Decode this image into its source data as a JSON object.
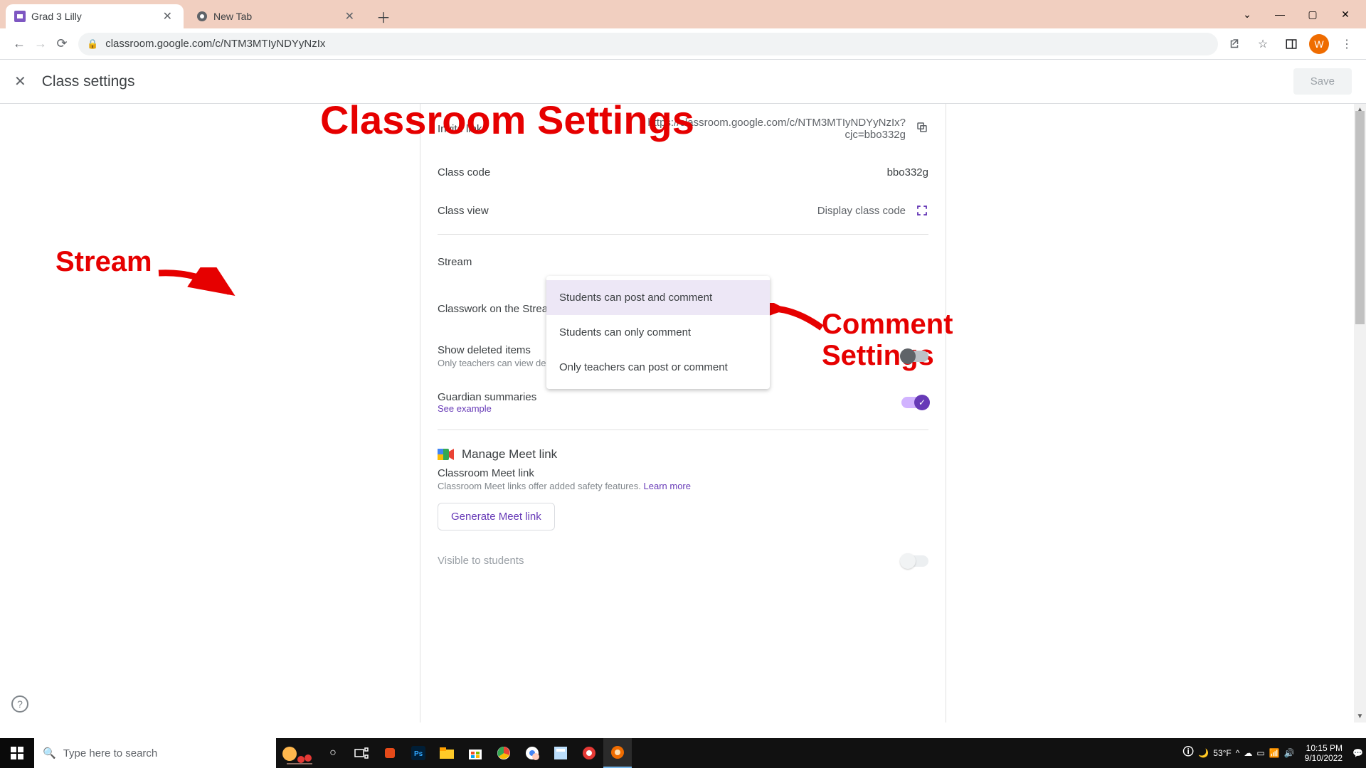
{
  "browser": {
    "tabs": [
      {
        "title": "Grad 3 Lilly",
        "active": true
      },
      {
        "title": "New Tab",
        "active": false
      }
    ],
    "url": "classroom.google.com/c/NTM3MTIyNDYyNzIx",
    "avatar_letter": "W"
  },
  "header": {
    "title": "Class settings",
    "save": "Save"
  },
  "settings": {
    "invite_link": {
      "label": "Invite link",
      "value": "https://classroom.google.com/c/NTM3MTIyNDYyNzIx?cjc=bbo332g"
    },
    "class_code": {
      "label": "Class code",
      "value": "bbo332g"
    },
    "class_view": {
      "label": "Class view",
      "action": "Display class code"
    },
    "stream": {
      "label": "Stream"
    },
    "classwork_stream": {
      "label": "Classwork on the Stream"
    },
    "show_deleted": {
      "label": "Show deleted items",
      "sub": "Only teachers can view deleted items."
    },
    "guardian": {
      "label": "Guardian summaries",
      "link": "See example"
    },
    "meet": {
      "header": "Manage Meet link",
      "sub_title": "Classroom Meet link",
      "sub_desc": "Classroom Meet links offer added safety features. ",
      "learn_more": "Learn more",
      "button": "Generate Meet link",
      "visible": "Visible to students"
    }
  },
  "dropdown": {
    "options": [
      "Students can post and comment",
      "Students can only comment",
      "Only teachers can post or comment"
    ]
  },
  "annotations": {
    "title": "Classroom Settings",
    "stream": "Stream",
    "comment_line1": "Comment",
    "comment_line2": "Settings"
  },
  "taskbar": {
    "search_placeholder": "Type here to search",
    "weather": "53°F",
    "time": "10:15 PM",
    "date": "9/10/2022"
  }
}
